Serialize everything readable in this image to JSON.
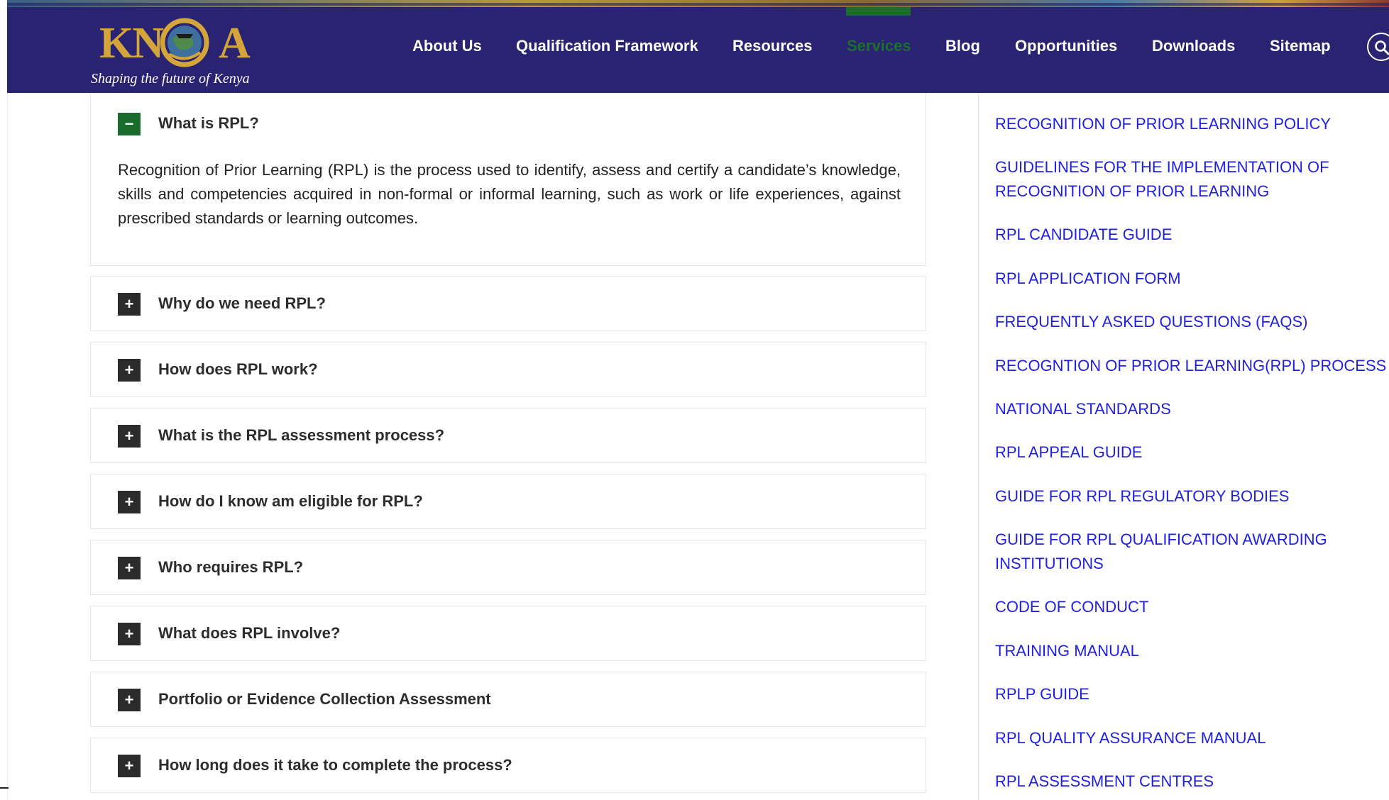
{
  "brand": {
    "logo_left": "KN",
    "logo_right": "A",
    "tagline": "Shaping the future of Kenya",
    "colors": {
      "header": "#2a2372",
      "gold": "#d4a53a",
      "active": "#1c6e2e",
      "link": "#1f1fe0"
    }
  },
  "nav": {
    "items": [
      {
        "label": "About Us"
      },
      {
        "label": "Qualification Framework"
      },
      {
        "label": "Resources"
      },
      {
        "label": "Services",
        "active": true
      },
      {
        "label": "Blog"
      },
      {
        "label": "Opportunities"
      },
      {
        "label": "Downloads"
      },
      {
        "label": "Sitemap"
      }
    ],
    "search_icon": "search-icon"
  },
  "faq": {
    "open": {
      "question": "What is RPL?",
      "toggle": "−",
      "answer": "Recognition of Prior Learning (RPL) is the process used to identify, assess and certify a candidate’s knowledge, skills and competencies acquired in non-formal or informal learning, such as work or life experiences, against prescribed standards or learning outcomes."
    },
    "items": [
      {
        "question": "Why do we need RPL?",
        "toggle": "+"
      },
      {
        "question": "How does RPL work?",
        "toggle": "+"
      },
      {
        "question": "What is the RPL assessment process?",
        "toggle": "+"
      },
      {
        "question": "How do I know am eligible for RPL?",
        "toggle": "+"
      },
      {
        "question": "Who requires RPL?",
        "toggle": "+"
      },
      {
        "question": "What does RPL involve?",
        "toggle": "+"
      },
      {
        "question": "Portfolio or Evidence Collection Assessment",
        "toggle": "+"
      },
      {
        "question": "How long does it take to complete the process?",
        "toggle": "+"
      }
    ]
  },
  "sidebar": {
    "links": [
      "RECOGNITION OF PRIOR LEARNING POLICY",
      "GUIDELINES FOR THE IMPLEMENTATION OF",
      "RECOGNITION OF PRIOR LEARNING",
      "RPL CANDIDATE GUIDE",
      "RPL APPLICATION FORM",
      "FREQUENTLY ASKED QUESTIONS (FAQS)",
      "RECOGNTION OF PRIOR LEARNING(RPL) PROCESS",
      "NATIONAL STANDARDS",
      "RPL APPEAL GUIDE",
      "GUIDE FOR RPL REGULATORY BODIES",
      "GUIDE FOR RPL QUALIFICATION AWARDING",
      "INSTITUTIONS",
      "CODE OF CONDUCT",
      "TRAINING MANUAL",
      "RPLP GUIDE",
      "RPL QUALITY ASSURANCE MANUAL",
      "RPL ASSESSMENT CENTRES"
    ]
  }
}
